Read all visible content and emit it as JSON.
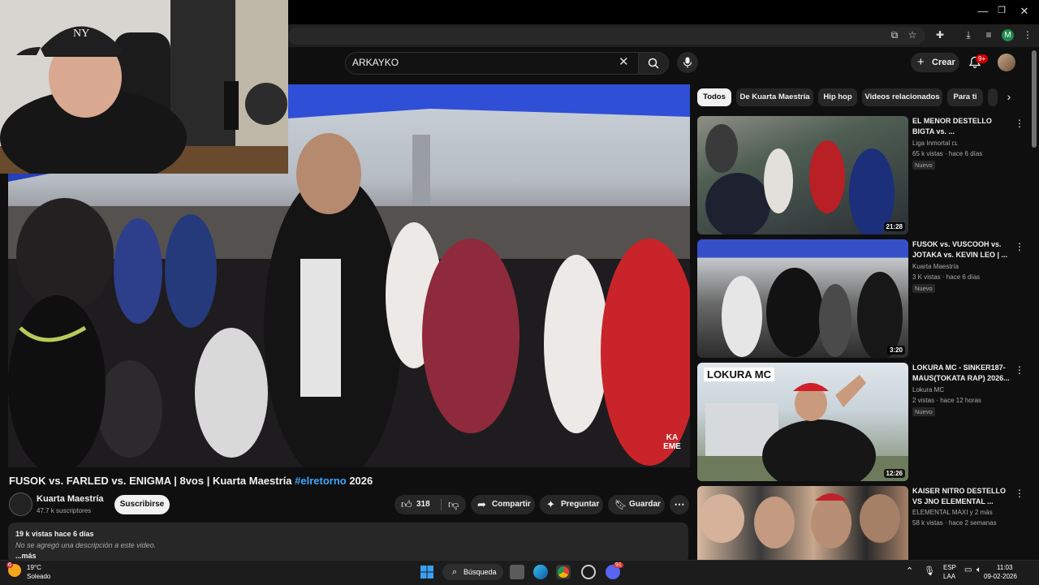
{
  "browser": {
    "window_controls": [
      "—",
      "❐",
      "✕"
    ],
    "profile_initial": "M"
  },
  "header": {
    "search_value": "ARKAYKO",
    "create_label": "Crear",
    "notification_count": "9+"
  },
  "video": {
    "watermark": "KA EME",
    "title": "FUSOK vs. FARLED vs. ENIGMA | 8vos | Kuarta Maestría",
    "hashtag": "#elretorno",
    "title_year": "2026"
  },
  "channel": {
    "name": "Kuarta Maestría",
    "subscribers": "47.7 k suscriptores",
    "subscribe_label": "Suscribirse"
  },
  "actions": {
    "likes": "318",
    "share": "Compartir",
    "ask": "Preguntar",
    "save": "Guardar"
  },
  "description": {
    "views_date": "19 k vistas  hace 6 días",
    "no_description": "No se agregó una descripción a este video.",
    "more": "...más"
  },
  "chips": [
    {
      "label": "Todos",
      "active": true
    },
    {
      "label": "De Kuarta Maestría",
      "active": false
    },
    {
      "label": "Hip hop",
      "active": false
    },
    {
      "label": "Videos relacionados",
      "active": false
    },
    {
      "label": "Para ti",
      "active": false
    }
  ],
  "recommendations": [
    {
      "title": "EL MENOR DESTELLO BIGTA vs. ...",
      "channel": "Liga Inmortal ᴄʟ",
      "meta": "65 k vistas · hace 6 días",
      "badge": "Nuevo",
      "duration": "21:28"
    },
    {
      "title": "FUSOK vs. VUSCOOH vs. JOTAKA vs. KEVIN LEO | ...",
      "channel": "Kuarta Maestría",
      "meta": "3 K vistas · hace 6 días",
      "badge": "Nuevo",
      "duration": "3:20"
    },
    {
      "title": "LOKURA MC - SINKER187- MAUS(TOKATA RAP) 2026...",
      "channel": "Lokura MC",
      "meta": "2 vistas · hace 12 horas",
      "badge": "Nuevo",
      "duration": "12:26",
      "thumb_text": "LOKURA MC"
    },
    {
      "title": "KAISER NITRO DESTELLO VS JNO ELEMENTAL ...",
      "channel": "ELEMENTAL MAXI y 2 más",
      "meta": "58 k vistas · hace 2 semanas",
      "badge": "",
      "duration": ""
    }
  ],
  "taskbar": {
    "weather_temp": "19°C",
    "weather_desc": "Soleado",
    "weather_badge": "6",
    "search_label": "Búsqueda",
    "lang": "ESP",
    "lang2": "LAA",
    "time": "11:03",
    "date": "09-02-2026",
    "discord_badge": "91"
  }
}
